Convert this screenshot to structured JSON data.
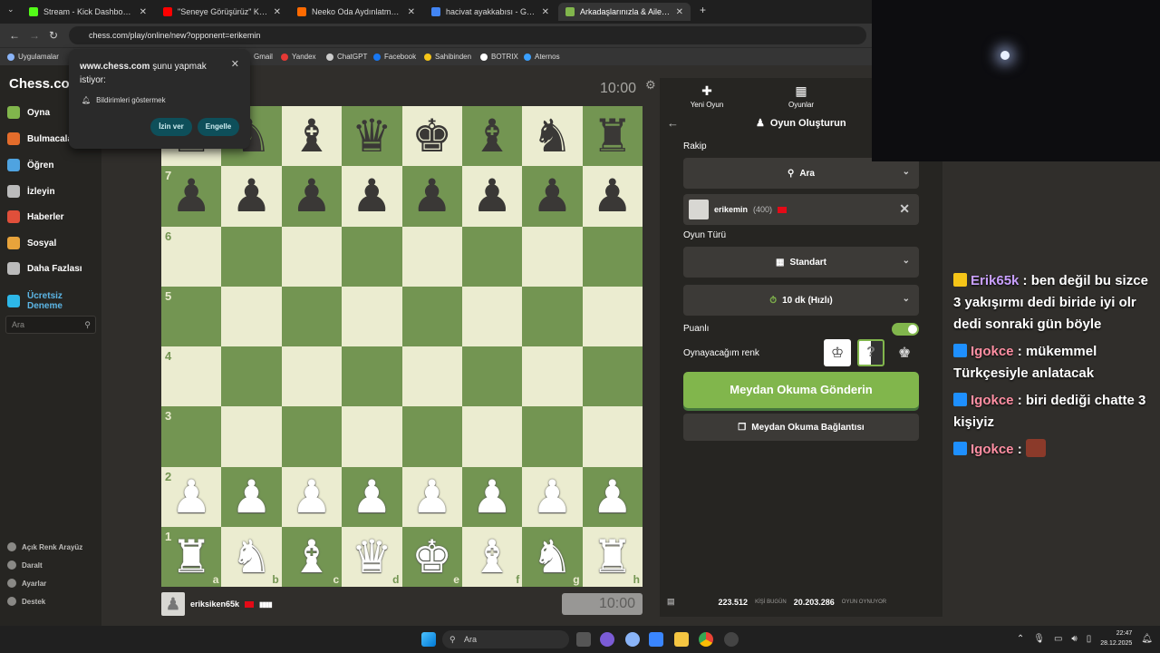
{
  "browser": {
    "tabs": [
      {
        "title": "Stream - Kick Dashboard",
        "color": "#53fc18"
      },
      {
        "title": "\"Seneye Görüşürüz\" Kick & Tw",
        "color": "#ff0000"
      },
      {
        "title": "Neeko Oda Aydınlatma Sistem",
        "color": "#ff6a00"
      },
      {
        "title": "hacivat ayakkabısı - Google'da",
        "color": "#4285f4"
      },
      {
        "title": "Arkadaşlarınızla & Ailenizle Üc",
        "color": "#81b64c"
      }
    ],
    "url": "chess.com/play/online/new?opponent=erikemin",
    "bookmarks": [
      "Uygulamalar",
      "Gmail",
      "Yandex",
      "ChatGPT",
      "Facebook",
      "Sahibinden",
      "BOTRIX",
      "Aternos"
    ]
  },
  "permission": {
    "title_site": "www.chess.com",
    "title_rest": " şunu yapmak istiyor:",
    "item": "Bildirimleri göstermek",
    "allow": "İzin ver",
    "block": "Engelle"
  },
  "sidebar": {
    "logo": "Chess.com",
    "items": [
      "Oyna",
      "Bulmacalar",
      "Öğren",
      "İzleyin",
      "Haberler",
      "Sosyal",
      "Daha Fazlası",
      "Ücretsiz Deneme"
    ],
    "search_placeholder": "Ara",
    "footer": [
      "Açık Renk Arayüz",
      "Daralt",
      "Ayarlar",
      "Destek"
    ]
  },
  "board": {
    "rows": [
      [
        "r",
        "n",
        "b",
        "q",
        "k",
        "b",
        "n",
        "r"
      ],
      [
        "p",
        "p",
        "p",
        "p",
        "p",
        "p",
        "p",
        "p"
      ],
      [
        "",
        "",
        "",
        "",
        "",
        "",
        "",
        ""
      ],
      [
        "",
        "",
        "",
        "",
        "",
        "",
        "",
        ""
      ],
      [
        "",
        "",
        "",
        "",
        "",
        "",
        "",
        ""
      ],
      [
        "",
        "",
        "",
        "",
        "",
        "",
        "",
        ""
      ],
      [
        "P",
        "P",
        "P",
        "P",
        "P",
        "P",
        "P",
        "P"
      ],
      [
        "R",
        "N",
        "B",
        "Q",
        "K",
        "B",
        "N",
        "R"
      ]
    ],
    "ranks": [
      "8",
      "7",
      "6",
      "5",
      "4",
      "3",
      "2",
      "1"
    ],
    "files": [
      "a",
      "b",
      "c",
      "d",
      "e",
      "f",
      "g",
      "h"
    ],
    "top_clock": "10:00",
    "bottom_clock": "10:00",
    "player_name": "eriksiken65k"
  },
  "panel": {
    "tabs": [
      "Yeni Oyun",
      "Oyunlar"
    ],
    "title": "Oyun Oluşturun",
    "opponent_label": "Rakip",
    "search_label": "Ara",
    "opponent_name": "erikemin",
    "opponent_rating": "(400)",
    "game_type_label": "Oyun Türü",
    "game_type": "Standart",
    "time_control": "10 dk (Hızlı)",
    "rated_label": "Puanlı",
    "color_label": "Oynayacağım renk",
    "send_button": "Meydan Okuma Gönderin",
    "link_button": "Meydan Okuma Bağlantısı",
    "stat_players": "223.512",
    "stat_players_label": "KİŞİ BUGÜN",
    "stat_games": "20.203.286",
    "stat_games_label": "OYUN OYNUYOR",
    "accent": "#81b64c"
  },
  "chat": [
    {
      "user": "Erik65k",
      "user_color": "#c9a0ff",
      "badge_color": "#f5c518",
      "text": " : ben değil bu sizce 3 yakışırmı dedi biride iyi olr dedi sonraki gün böyle"
    },
    {
      "user": "Igokce",
      "user_color": "#ff8fa3",
      "badge_color": "#1e90ff",
      "text": " : mükemmel Türkçesiyle anlatacak"
    },
    {
      "user": "Igokce",
      "user_color": "#ff8fa3",
      "badge_color": "#1e90ff",
      "text": " : biri dediği chatte 3 kişiyiz"
    },
    {
      "user": "Igokce",
      "user_color": "#ff8fa3",
      "badge_color": "#1e90ff",
      "text": " : "
    }
  ],
  "taskbar": {
    "search": "Ara",
    "time": "22:47",
    "date": "28.12.2025"
  }
}
